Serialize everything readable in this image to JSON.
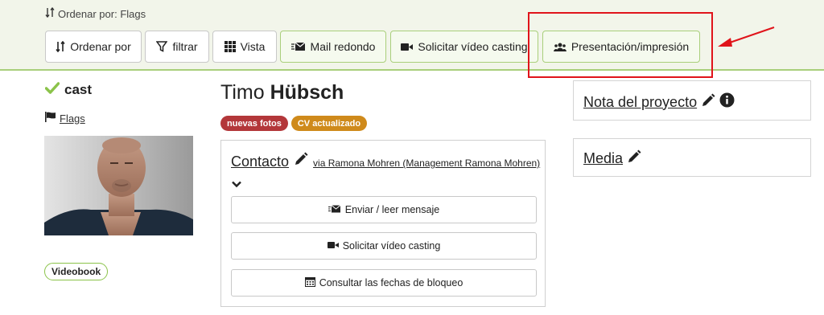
{
  "toolbar": {
    "sort_status": "Ordenar por: Flags",
    "buttons": {
      "sort": "Ordenar por",
      "filter": "filtrar",
      "view": "Vista",
      "mail": "Mail redondo",
      "video": "Solicitar vídeo casting",
      "presentation": "Presentación/impresión"
    }
  },
  "profile": {
    "status": "cast",
    "flags_link": "Flags",
    "videobook": "Videobook",
    "first_name": "Timo",
    "last_name": "Hübsch",
    "badges": [
      {
        "label": "nuevas fotos",
        "color": "#b3373a"
      },
      {
        "label": "CV actualizado",
        "color": "#cf8a1b"
      }
    ]
  },
  "contact": {
    "title": "Contacto",
    "via": "via Ramona Mohren (Management Ramona Mohren)",
    "actions": {
      "message": "Enviar / leer mensaje",
      "video": "Solicitar vídeo casting",
      "dates": "Consultar las fechas de bloqueo"
    }
  },
  "side": {
    "project_note": "Nota del proyecto",
    "media": "Media"
  },
  "colors": {
    "accent_green": "#8bc34a",
    "annotation_red": "#e0141b"
  }
}
